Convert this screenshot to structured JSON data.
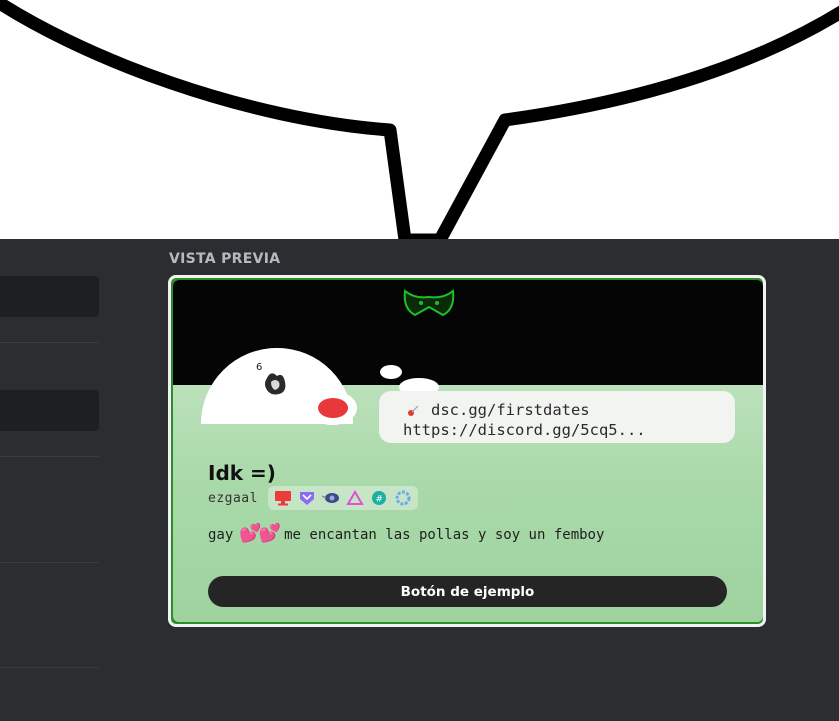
{
  "preview": {
    "section_label": "VISTA PREVIA"
  },
  "profile": {
    "custom_status_line1": "dsc.gg/firstdates",
    "custom_status_line2": "https://discord.gg/5cq5...",
    "display_name": "Idk =)",
    "username": "ezgaal",
    "bio_prefix": "gay",
    "bio_hearts": "💕💕",
    "bio_text": "me encantan las pollas y soy un femboy",
    "example_button_label": "Botón de ejemplo"
  },
  "colors": {
    "panel_bg": "#2b2d31",
    "card_border": "#2a8f2a",
    "banner": "#050505",
    "status_online": "#e8383c"
  }
}
